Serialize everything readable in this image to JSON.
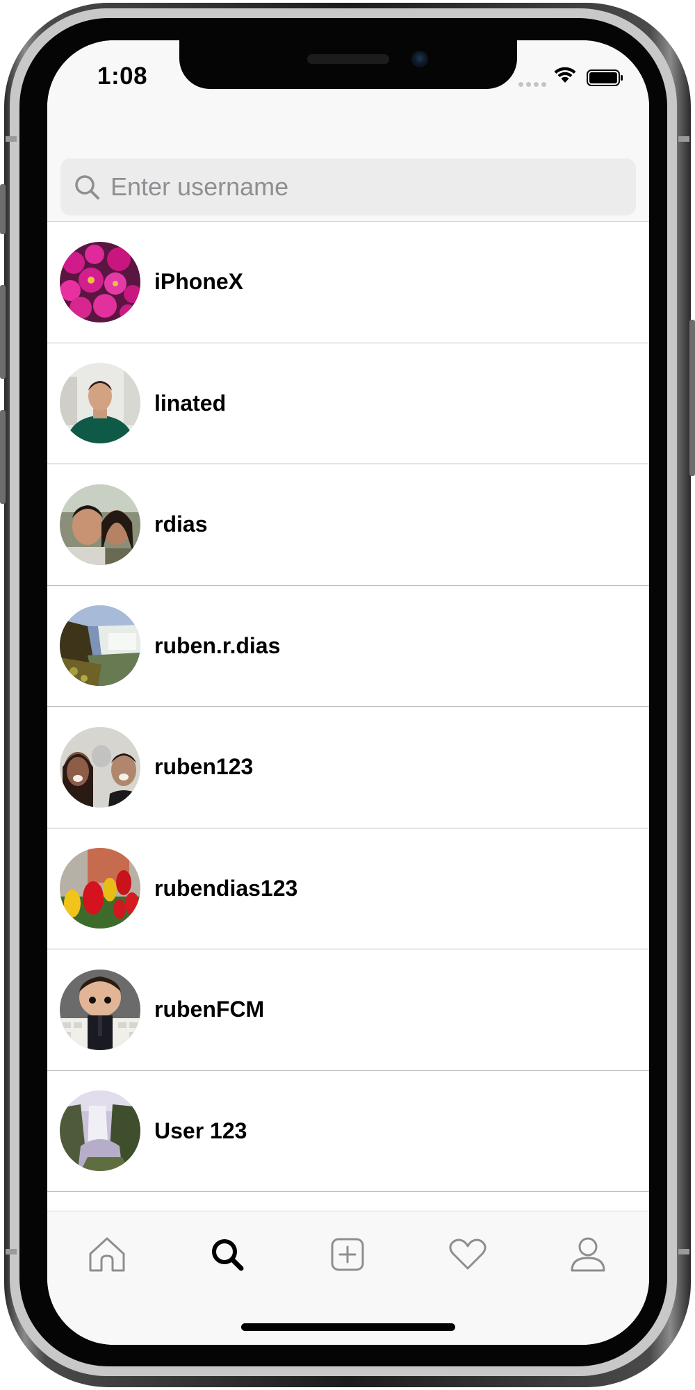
{
  "status_bar": {
    "time": "1:08",
    "signal_icon": "signal-dots-icon",
    "wifi_icon": "wifi-icon",
    "battery_icon": "battery-icon"
  },
  "search": {
    "placeholder": "Enter username",
    "value": "",
    "icon": "search-icon"
  },
  "users": [
    {
      "username": "iPhoneX",
      "avatar": "avatar-pink-flowers"
    },
    {
      "username": "linated",
      "avatar": "avatar-man-green-sweater"
    },
    {
      "username": "rdias",
      "avatar": "avatar-couple-selfie"
    },
    {
      "username": "ruben.r.dias",
      "avatar": "avatar-waterfall-cliff"
    },
    {
      "username": "ruben123",
      "avatar": "avatar-selfie-dog-filter"
    },
    {
      "username": "rubendias123",
      "avatar": "avatar-tulips"
    },
    {
      "username": "rubenFCM",
      "avatar": "avatar-figurine-keyboard"
    },
    {
      "username": "User 123",
      "avatar": "avatar-waterfall-mist"
    }
  ],
  "tab_bar": {
    "tabs": [
      {
        "name": "home",
        "icon": "home-icon",
        "active": false
      },
      {
        "name": "search",
        "icon": "search-icon",
        "active": true
      },
      {
        "name": "add",
        "icon": "plus-square-icon",
        "active": false
      },
      {
        "name": "activity",
        "icon": "heart-icon",
        "active": false
      },
      {
        "name": "profile",
        "icon": "person-icon",
        "active": false
      }
    ],
    "active_color": "#000000",
    "inactive_color": "#8e8e8e"
  }
}
